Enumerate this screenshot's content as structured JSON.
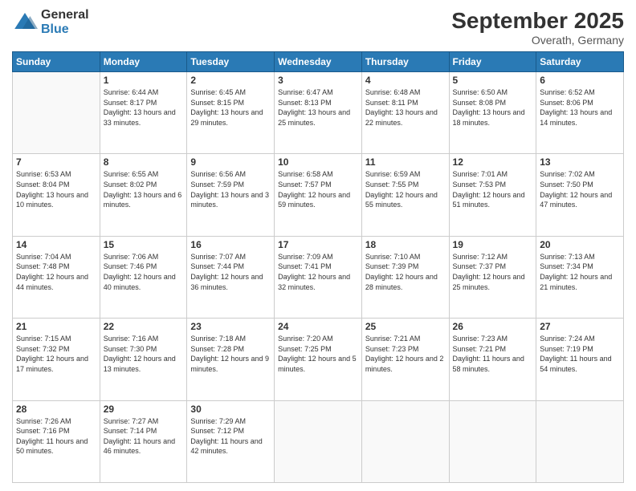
{
  "logo": {
    "general": "General",
    "blue": "Blue"
  },
  "header": {
    "title": "September 2025",
    "subtitle": "Overath, Germany"
  },
  "weekdays": [
    "Sunday",
    "Monday",
    "Tuesday",
    "Wednesday",
    "Thursday",
    "Friday",
    "Saturday"
  ],
  "weeks": [
    [
      {
        "day": "",
        "sunrise": "",
        "sunset": "",
        "daylight": ""
      },
      {
        "day": "1",
        "sunrise": "Sunrise: 6:44 AM",
        "sunset": "Sunset: 8:17 PM",
        "daylight": "Daylight: 13 hours and 33 minutes."
      },
      {
        "day": "2",
        "sunrise": "Sunrise: 6:45 AM",
        "sunset": "Sunset: 8:15 PM",
        "daylight": "Daylight: 13 hours and 29 minutes."
      },
      {
        "day": "3",
        "sunrise": "Sunrise: 6:47 AM",
        "sunset": "Sunset: 8:13 PM",
        "daylight": "Daylight: 13 hours and 25 minutes."
      },
      {
        "day": "4",
        "sunrise": "Sunrise: 6:48 AM",
        "sunset": "Sunset: 8:11 PM",
        "daylight": "Daylight: 13 hours and 22 minutes."
      },
      {
        "day": "5",
        "sunrise": "Sunrise: 6:50 AM",
        "sunset": "Sunset: 8:08 PM",
        "daylight": "Daylight: 13 hours and 18 minutes."
      },
      {
        "day": "6",
        "sunrise": "Sunrise: 6:52 AM",
        "sunset": "Sunset: 8:06 PM",
        "daylight": "Daylight: 13 hours and 14 minutes."
      }
    ],
    [
      {
        "day": "7",
        "sunrise": "Sunrise: 6:53 AM",
        "sunset": "Sunset: 8:04 PM",
        "daylight": "Daylight: 13 hours and 10 minutes."
      },
      {
        "day": "8",
        "sunrise": "Sunrise: 6:55 AM",
        "sunset": "Sunset: 8:02 PM",
        "daylight": "Daylight: 13 hours and 6 minutes."
      },
      {
        "day": "9",
        "sunrise": "Sunrise: 6:56 AM",
        "sunset": "Sunset: 7:59 PM",
        "daylight": "Daylight: 13 hours and 3 minutes."
      },
      {
        "day": "10",
        "sunrise": "Sunrise: 6:58 AM",
        "sunset": "Sunset: 7:57 PM",
        "daylight": "Daylight: 12 hours and 59 minutes."
      },
      {
        "day": "11",
        "sunrise": "Sunrise: 6:59 AM",
        "sunset": "Sunset: 7:55 PM",
        "daylight": "Daylight: 12 hours and 55 minutes."
      },
      {
        "day": "12",
        "sunrise": "Sunrise: 7:01 AM",
        "sunset": "Sunset: 7:53 PM",
        "daylight": "Daylight: 12 hours and 51 minutes."
      },
      {
        "day": "13",
        "sunrise": "Sunrise: 7:02 AM",
        "sunset": "Sunset: 7:50 PM",
        "daylight": "Daylight: 12 hours and 47 minutes."
      }
    ],
    [
      {
        "day": "14",
        "sunrise": "Sunrise: 7:04 AM",
        "sunset": "Sunset: 7:48 PM",
        "daylight": "Daylight: 12 hours and 44 minutes."
      },
      {
        "day": "15",
        "sunrise": "Sunrise: 7:06 AM",
        "sunset": "Sunset: 7:46 PM",
        "daylight": "Daylight: 12 hours and 40 minutes."
      },
      {
        "day": "16",
        "sunrise": "Sunrise: 7:07 AM",
        "sunset": "Sunset: 7:44 PM",
        "daylight": "Daylight: 12 hours and 36 minutes."
      },
      {
        "day": "17",
        "sunrise": "Sunrise: 7:09 AM",
        "sunset": "Sunset: 7:41 PM",
        "daylight": "Daylight: 12 hours and 32 minutes."
      },
      {
        "day": "18",
        "sunrise": "Sunrise: 7:10 AM",
        "sunset": "Sunset: 7:39 PM",
        "daylight": "Daylight: 12 hours and 28 minutes."
      },
      {
        "day": "19",
        "sunrise": "Sunrise: 7:12 AM",
        "sunset": "Sunset: 7:37 PM",
        "daylight": "Daylight: 12 hours and 25 minutes."
      },
      {
        "day": "20",
        "sunrise": "Sunrise: 7:13 AM",
        "sunset": "Sunset: 7:34 PM",
        "daylight": "Daylight: 12 hours and 21 minutes."
      }
    ],
    [
      {
        "day": "21",
        "sunrise": "Sunrise: 7:15 AM",
        "sunset": "Sunset: 7:32 PM",
        "daylight": "Daylight: 12 hours and 17 minutes."
      },
      {
        "day": "22",
        "sunrise": "Sunrise: 7:16 AM",
        "sunset": "Sunset: 7:30 PM",
        "daylight": "Daylight: 12 hours and 13 minutes."
      },
      {
        "day": "23",
        "sunrise": "Sunrise: 7:18 AM",
        "sunset": "Sunset: 7:28 PM",
        "daylight": "Daylight: 12 hours and 9 minutes."
      },
      {
        "day": "24",
        "sunrise": "Sunrise: 7:20 AM",
        "sunset": "Sunset: 7:25 PM",
        "daylight": "Daylight: 12 hours and 5 minutes."
      },
      {
        "day": "25",
        "sunrise": "Sunrise: 7:21 AM",
        "sunset": "Sunset: 7:23 PM",
        "daylight": "Daylight: 12 hours and 2 minutes."
      },
      {
        "day": "26",
        "sunrise": "Sunrise: 7:23 AM",
        "sunset": "Sunset: 7:21 PM",
        "daylight": "Daylight: 11 hours and 58 minutes."
      },
      {
        "day": "27",
        "sunrise": "Sunrise: 7:24 AM",
        "sunset": "Sunset: 7:19 PM",
        "daylight": "Daylight: 11 hours and 54 minutes."
      }
    ],
    [
      {
        "day": "28",
        "sunrise": "Sunrise: 7:26 AM",
        "sunset": "Sunset: 7:16 PM",
        "daylight": "Daylight: 11 hours and 50 minutes."
      },
      {
        "day": "29",
        "sunrise": "Sunrise: 7:27 AM",
        "sunset": "Sunset: 7:14 PM",
        "daylight": "Daylight: 11 hours and 46 minutes."
      },
      {
        "day": "30",
        "sunrise": "Sunrise: 7:29 AM",
        "sunset": "Sunset: 7:12 PM",
        "daylight": "Daylight: 11 hours and 42 minutes."
      },
      {
        "day": "",
        "sunrise": "",
        "sunset": "",
        "daylight": ""
      },
      {
        "day": "",
        "sunrise": "",
        "sunset": "",
        "daylight": ""
      },
      {
        "day": "",
        "sunrise": "",
        "sunset": "",
        "daylight": ""
      },
      {
        "day": "",
        "sunrise": "",
        "sunset": "",
        "daylight": ""
      }
    ]
  ]
}
